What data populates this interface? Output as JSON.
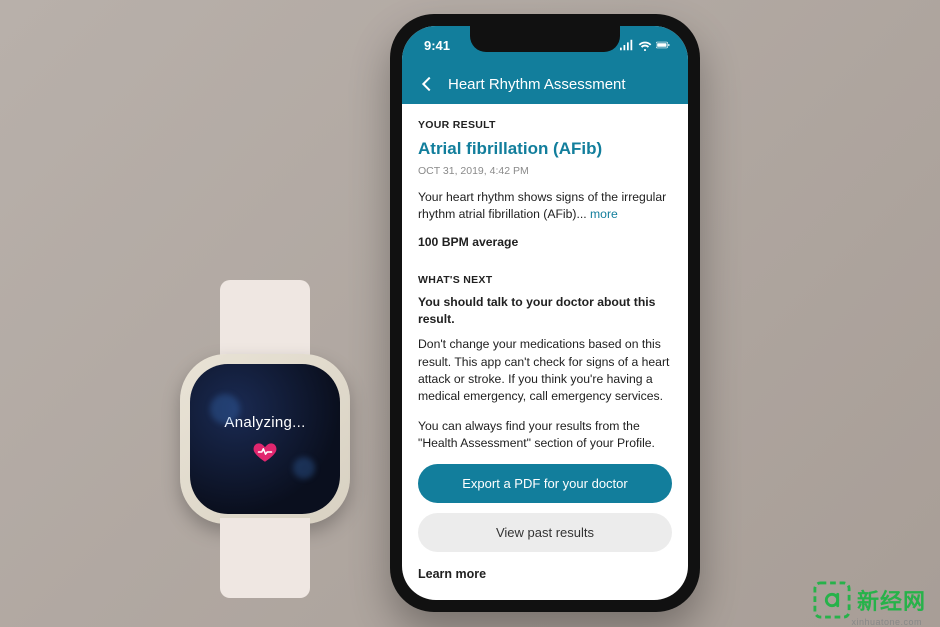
{
  "watch": {
    "status_text": "Analyzing..."
  },
  "phone": {
    "status": {
      "time": "9:41"
    },
    "nav": {
      "title": "Heart Rhythm Assessment"
    },
    "result": {
      "section_label": "YOUR RESULT",
      "title": "Atrial fibrillation (AFib)",
      "timestamp": "OCT 31, 2019, 4:42 PM",
      "body_first": "Your heart rhythm shows signs of the irregular rhythm atrial fibrillation (AFib)... ",
      "more_label": "more",
      "bpm": "100 BPM average"
    },
    "next": {
      "section_label": "WHAT'S NEXT",
      "lead": "You should talk to your doctor about this result.",
      "p1": "Don't change your medications based on this result. This app can't check for signs of a heart attack or stroke. If you think you're having a medical emergency, call emergency services.",
      "p2": "You can always find your results from the \"Health Assessment\" section of your Profile."
    },
    "actions": {
      "primary": "Export a PDF for your doctor",
      "secondary": "View past results",
      "learn_more": "Learn more"
    }
  },
  "watermark": {
    "brand": "新经网",
    "domain": "xinhuatone.com"
  }
}
